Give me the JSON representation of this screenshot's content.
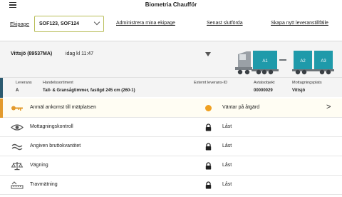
{
  "app": {
    "title": "Biometria Chaufför"
  },
  "nav": {
    "ekipage_label": "Ekipage",
    "ekipage_value": "SOF123, SOF124",
    "admin_link": "Administrera mina ekipage",
    "latest_link": "Senast slutförda",
    "create_link": "Skapa nytt leveranstillfälle"
  },
  "vehicle": {
    "name": "Vittsjö (89537MA)",
    "time": "idag kl 11:47",
    "units": [
      "A1",
      "A2",
      "A3"
    ],
    "truck_color": "#1f9aaa"
  },
  "delivery": {
    "leverans_label": "Leverans",
    "leverans_value": "A",
    "sortiment_label": "Handelssortiment",
    "sortiment_value": "Tall- & Gransågtimmer, fastlgd 245 cm (260-1)",
    "extern_label": "Externt leverans-ID",
    "avtal_label": "Avtalsobjekt",
    "avtal_value": "00000029",
    "mottag_label": "Mottagningsplats",
    "mottag_value": "Vittsjö"
  },
  "steps": [
    {
      "label": "Anmäl ankomst till mätplatsen",
      "icon": "key-icon",
      "status": "Väntar på åtgärd",
      "status_icon": "pending-dot-icon",
      "status_color": "#f0a020"
    },
    {
      "label": "Mottagningskontroll",
      "icon": "eye-icon",
      "status": "Låst",
      "status_icon": "lock-icon"
    },
    {
      "label": "Angiven bruttokvantitet",
      "icon": "approx-icon",
      "status": "Låst",
      "status_icon": "lock-icon"
    },
    {
      "label": "Vägning",
      "icon": "scale-icon",
      "status": "Låst",
      "status_icon": "lock-icon"
    },
    {
      "label": "Travmätning",
      "icon": "ruler-icon",
      "status": "Låst",
      "status_icon": "lock-icon"
    }
  ],
  "colors": {
    "accent": "#b8bd58",
    "active": "#e39a2c",
    "bar": "#2b5a70"
  }
}
